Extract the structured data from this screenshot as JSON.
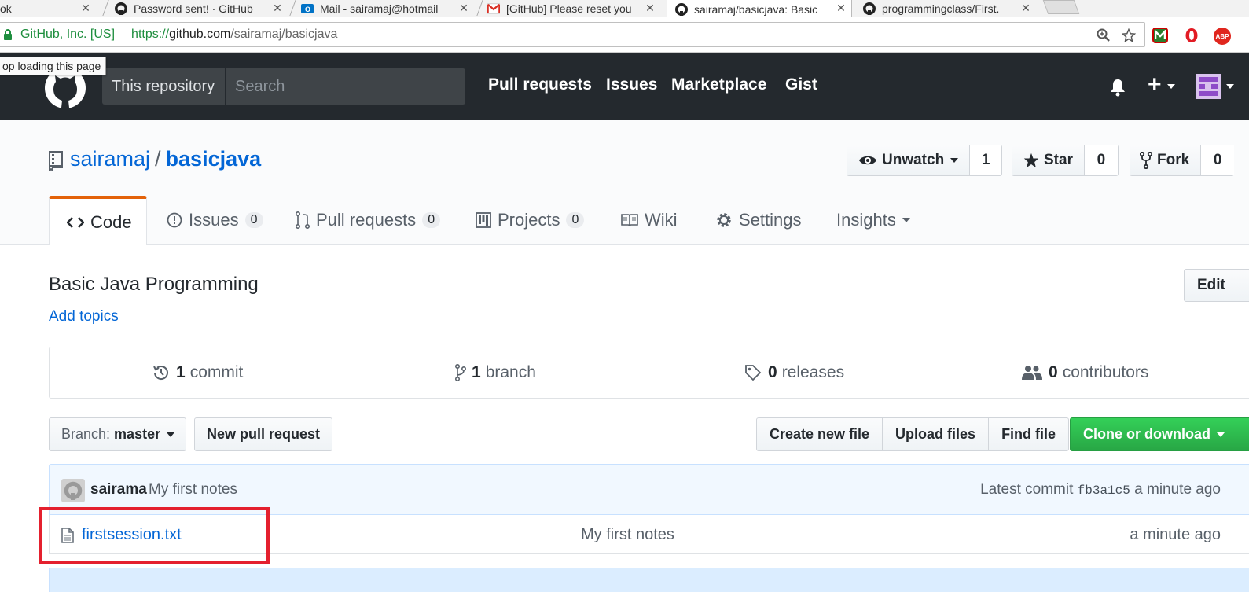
{
  "browser": {
    "tabs": [
      {
        "title": "ok",
        "favicon": "page-icon"
      },
      {
        "title": "Password sent! · GitHub",
        "favicon": "github-icon"
      },
      {
        "title": "Mail - sairamaj@hotmail",
        "favicon": "outlook-icon"
      },
      {
        "title": "[GitHub] Please reset you",
        "favicon": "gmail-icon"
      },
      {
        "title": "sairamaj/basicjava: Basic",
        "favicon": "github-icon",
        "active": true
      },
      {
        "title": "programmingclass/First.",
        "favicon": "github-icon"
      }
    ],
    "address": {
      "secure_label": "GitHub, Inc. [US]",
      "url_scheme": "https://",
      "url_host": "github.com",
      "url_path": "/sairamaj/basicjava"
    },
    "extensions": [
      "mcafee-icon",
      "opera-icon",
      "adblock-plus-icon"
    ],
    "extension_label_abp": "ABP",
    "tooltip": "op loading this page"
  },
  "github": {
    "scope_label": "This repository",
    "search_placeholder": "Search",
    "nav": [
      "Pull requests",
      "Issues",
      "Marketplace",
      "Gist"
    ]
  },
  "repo": {
    "owner": "sairamaj",
    "separator": "/",
    "name": "basicjava",
    "watch": {
      "label": "Unwatch",
      "count": "1"
    },
    "star": {
      "label": "Star",
      "count": "0"
    },
    "fork": {
      "label": "Fork",
      "count": "0"
    },
    "tabs": {
      "code": "Code",
      "issues": {
        "label": "Issues",
        "count": "0"
      },
      "pulls": {
        "label": "Pull requests",
        "count": "0"
      },
      "projects": {
        "label": "Projects",
        "count": "0"
      },
      "wiki": "Wiki",
      "settings": "Settings",
      "insights": "Insights"
    },
    "description": "Basic Java Programming",
    "add_topics": "Add topics",
    "edit_label": "Edit",
    "summary": {
      "commits": {
        "count": "1",
        "label": "commit"
      },
      "branches": {
        "count": "1",
        "label": "branch"
      },
      "releases": {
        "count": "0",
        "label": "releases"
      },
      "contributors": {
        "count": "0",
        "label": "contributors"
      }
    },
    "branch": {
      "prefix": "Branch:",
      "name": "master"
    },
    "new_pr": "New pull request",
    "file_actions": [
      "Create new file",
      "Upload files",
      "Find file"
    ],
    "clone": "Clone or download",
    "latest_commit": {
      "author": "sairama",
      "message": "My first notes",
      "prefix": "Latest commit",
      "sha": "fb3a1c5",
      "age": "a minute ago"
    },
    "files": [
      {
        "name": "firstsession.txt",
        "message": "My first notes",
        "age": "a minute ago"
      }
    ]
  },
  "colors": {
    "header_bg": "#24292e",
    "link": "#0366d6",
    "tab_accent": "#e36209",
    "clone_green": "#28a745",
    "highlight_box": "#e4202e"
  }
}
